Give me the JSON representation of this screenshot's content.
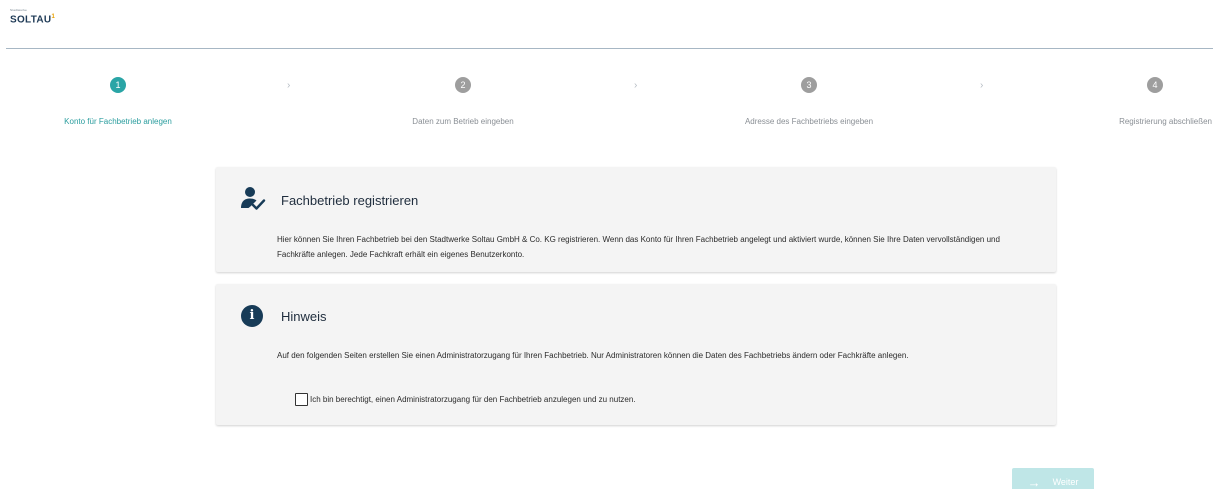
{
  "logo": {
    "small": "Stadtwerke",
    "name": "SOLTAU",
    "mark": "1"
  },
  "steps": [
    {
      "number": "1",
      "label": "Konto für Fachbetrieb anlegen",
      "active": true
    },
    {
      "number": "2",
      "label": "Daten zum Betrieb eingeben",
      "active": false
    },
    {
      "number": "3",
      "label": "Adresse des Fachbetriebs eingeben",
      "active": false
    },
    {
      "number": "4",
      "label": "Registrierung abschließen",
      "active": false
    }
  ],
  "separator": "›",
  "register_card": {
    "title": "Fachbetrieb registrieren",
    "text": "Hier können Sie Ihren Fachbetrieb bei den Stadtwerke Soltau GmbH & Co. KG registrieren. Wenn das Konto für Ihren Fachbetrieb angelegt und aktiviert wurde, können Sie Ihre Daten vervollständigen und Fachkräfte anlegen. Jede Fachkraft erhält ein eigenes Benutzerkonto.",
    "icon": "user-check-icon"
  },
  "hint_card": {
    "title": "Hinweis",
    "text": "Auf den folgenden Seiten erstellen Sie einen Administratorzugang für Ihren Fachbetrieb. Nur Administratoren können die Daten des Fachbetriebs ändern oder Fachkräfte anlegen.",
    "icon": "info-icon",
    "icon_glyph": "i",
    "checkbox_label": "Ich bin berechtigt, einen Administratorzugang für den Fachbetrieb anzulegen und zu nutzen.",
    "checkbox_checked": false
  },
  "next_button": {
    "label": "Weiter",
    "arrow": "→",
    "enabled": false
  },
  "colors": {
    "accent": "#2aa5a6",
    "navy": "#173b57",
    "disabled_button": "#bfe6e7"
  }
}
